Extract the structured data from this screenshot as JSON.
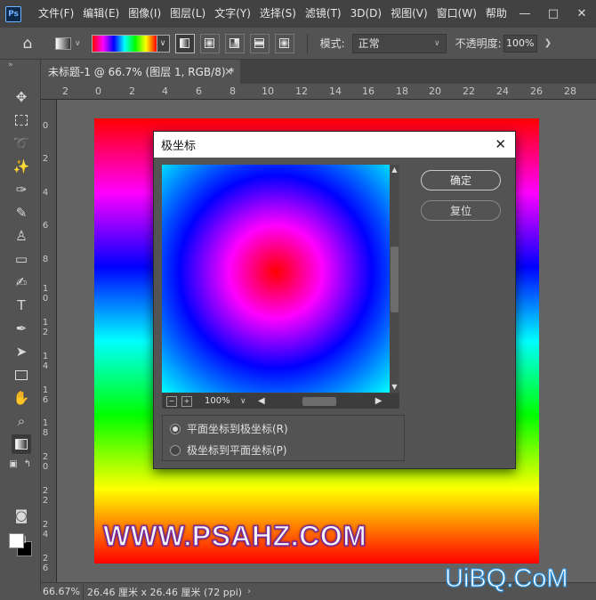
{
  "app": {
    "logo": "Ps"
  },
  "menu": [
    "文件(F)",
    "编辑(E)",
    "图像(I)",
    "图层(L)",
    "文字(Y)",
    "选择(S)",
    "滤镜(T)",
    "3D(D)",
    "视图(V)",
    "窗口(W)",
    "帮助"
  ],
  "window_controls": {
    "minimize_icon": "minimize-icon",
    "maximize_icon": "maximize-icon",
    "close_icon": "close-icon"
  },
  "options_bar": {
    "mode_label": "模式:",
    "mode_value": "正常",
    "opacity_label": "不透明度:",
    "opacity_value": "100%",
    "gradient_colors": [
      "#ff0000",
      "#ff00ff",
      "#0000ff",
      "#00ffff",
      "#00ff00",
      "#ffff00",
      "#ff0000"
    ]
  },
  "document_tab": {
    "title": "未标题-1 @ 66.7% (图层 1, RGB/8) *",
    "close": "×"
  },
  "ruler": {
    "top_ticks": [
      "2",
      "0",
      "2",
      "4",
      "6",
      "8",
      "10",
      "12",
      "14",
      "16",
      "18",
      "20",
      "22",
      "24",
      "26",
      "28"
    ],
    "left_ticks": [
      "0",
      "2",
      "4",
      "6",
      "8",
      "1\n0",
      "1\n2",
      "1\n4",
      "1\n6",
      "1\n8",
      "2\n0",
      "2\n2",
      "2\n4",
      "2\n6"
    ]
  },
  "canvas": {
    "watermark": "WWW.PSAHZ.COM"
  },
  "status": {
    "zoom": "66.67%",
    "doc_info": "26.46 厘米 x 26.46 厘米 (72 ppi)",
    "arrow": "›"
  },
  "site_logo": "UiBQ.CoM",
  "dialog": {
    "title": "极坐标",
    "close": "✕",
    "ok_label": "确定",
    "reset_label": "复位",
    "zoom_value": "100%",
    "options": [
      {
        "label": "平面坐标到极坐标(R)",
        "selected": true
      },
      {
        "label": "极坐标到平面坐标(P)",
        "selected": false
      }
    ]
  }
}
